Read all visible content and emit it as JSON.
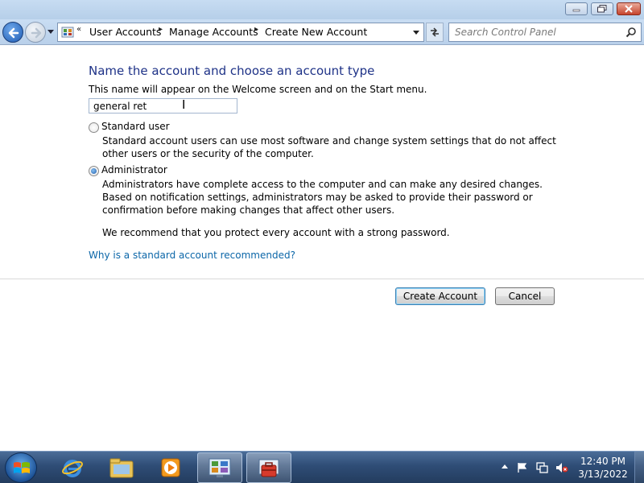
{
  "window": {
    "caption_buttons": {
      "minimize_icon": "minimize-icon",
      "maximize_icon": "restore-icon",
      "close_icon": "close-icon"
    }
  },
  "navbar": {
    "breadcrumb_prefix": "«",
    "breadcrumbs": [
      "User Accounts",
      "Manage Accounts",
      "Create New Account"
    ],
    "search_placeholder": "Search Control Panel"
  },
  "main": {
    "heading": "Name the account and choose an account type",
    "name_description": "This name will appear on the Welcome screen and on the Start menu.",
    "name_value": "general ret",
    "options": [
      {
        "label": "Standard user",
        "checked": false,
        "description": "Standard account users can use most software and change system settings that do not affect other users or the security of the computer."
      },
      {
        "label": "Administrator",
        "checked": true,
        "description": "Administrators have complete access to the computer and can make any desired changes. Based on notification settings, administrators may be asked to provide their password or confirmation before making changes that affect other users."
      }
    ],
    "recommendation": "We recommend that you protect every account with a strong password.",
    "help_link": "Why is a standard account recommended?",
    "create_button": "Create Account",
    "cancel_button": "Cancel"
  },
  "taskbar": {
    "apps": [
      "internet-explorer-icon",
      "windows-explorer-icon",
      "media-player-icon",
      "control-panel-icon",
      "user-accounts-icon"
    ],
    "active_apps": [
      "control-panel-icon",
      "user-accounts-icon"
    ],
    "tray_icons": [
      "show-hidden-icons",
      "action-center-flag-icon",
      "network-icon",
      "volume-muted-icon"
    ],
    "time": "12:40 PM",
    "date": "3/13/2022"
  },
  "colors": {
    "heading": "#1e3287",
    "link": "#0b66a8",
    "taskbar": "#2f4d76"
  }
}
